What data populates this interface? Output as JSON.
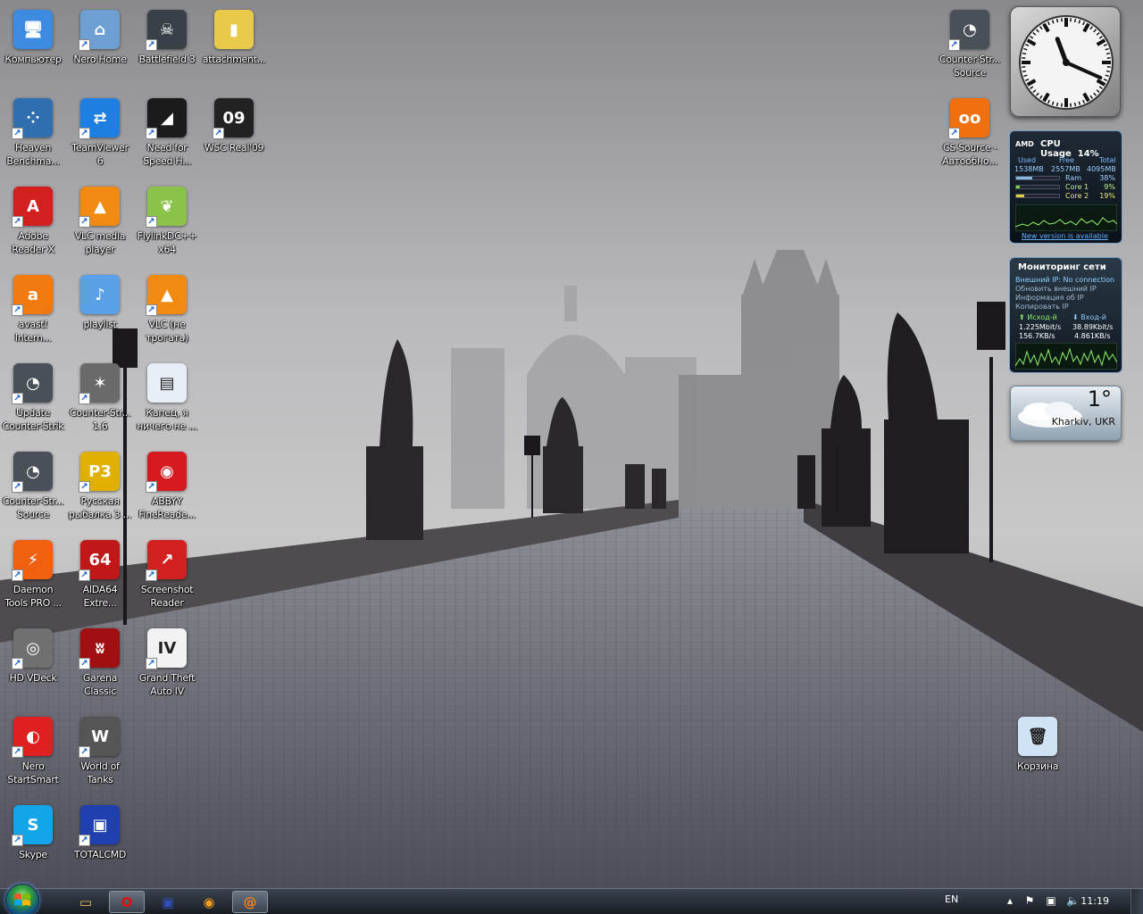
{
  "desktop_icons": [
    {
      "label": "Компьютер",
      "icon": "computer-icon",
      "col": 0,
      "row": 0,
      "color": "#3d8be0",
      "glyph": "🖥"
    },
    {
      "label": "Nero Home",
      "icon": "nero-home-icon",
      "col": 1,
      "row": 0,
      "color": "#6d9fd4",
      "glyph": "⌂"
    },
    {
      "label": "Battlefield 3",
      "icon": "battlefield-icon",
      "col": 2,
      "row": 0,
      "color": "#3a4048",
      "glyph": "☠"
    },
    {
      "label": "attachment...",
      "icon": "zip-folder-icon",
      "col": 3,
      "row": 0,
      "color": "#e8c94a",
      "glyph": "▮"
    },
    {
      "label": "Heaven\nBenchma...",
      "icon": "heaven-benchmark-icon",
      "col": 0,
      "row": 1,
      "color": "#2f6fb0",
      "glyph": "⁘"
    },
    {
      "label": "TeamViewer\n6",
      "icon": "teamviewer-icon",
      "col": 1,
      "row": 1,
      "color": "#1f7fe0",
      "glyph": "⇄"
    },
    {
      "label": "Need for\nSpeed H...",
      "icon": "need-for-speed-icon",
      "col": 2,
      "row": 1,
      "color": "#1b1b1b",
      "glyph": "◢"
    },
    {
      "label": "WSC Real'09",
      "icon": "wsc-real-icon",
      "col": 3,
      "row": 1,
      "color": "#222",
      "glyph": "09"
    },
    {
      "label": "Adobe\nReader X",
      "icon": "adobe-reader-icon",
      "col": 0,
      "row": 2,
      "color": "#d21f1f",
      "glyph": "A"
    },
    {
      "label": "VLC media\nplayer",
      "icon": "vlc-icon",
      "col": 1,
      "row": 2,
      "color": "#f08a10",
      "glyph": "▲"
    },
    {
      "label": "FlylinkDC++\nx64",
      "icon": "flylinkdc-icon",
      "col": 2,
      "row": 2,
      "color": "#8bc34a",
      "glyph": "❦"
    },
    {
      "label": "avast!\nIntern...",
      "icon": "avast-icon",
      "col": 0,
      "row": 3,
      "color": "#f07a10",
      "glyph": "a"
    },
    {
      "label": "playlist",
      "icon": "playlist-file-icon",
      "col": 1,
      "row": 3,
      "color": "#5aa0e6",
      "glyph": "♪"
    },
    {
      "label": "VLC (не\nтрогать)",
      "icon": "vlc-icon",
      "col": 2,
      "row": 3,
      "color": "#f08a10",
      "glyph": "▲"
    },
    {
      "label": "Update\nCounter-Strik\ne Source",
      "icon": "cs-source-icon",
      "col": 0,
      "row": 4,
      "color": "#4a5058",
      "glyph": "◔"
    },
    {
      "label": "Counter-Str...\n1.6",
      "icon": "counter-strike-icon",
      "col": 1,
      "row": 4,
      "color": "#6a6a6a",
      "glyph": "✶"
    },
    {
      "label": "Капец, я\nничего не ...",
      "icon": "screenshot-file-icon",
      "col": 2,
      "row": 4,
      "color": "#e8eef6",
      "glyph": "▤"
    },
    {
      "label": "Counter-Str...\nSource",
      "icon": "cs-source-icon",
      "col": 0,
      "row": 5,
      "color": "#4a5058",
      "glyph": "◔"
    },
    {
      "label": "Русская\nрыбалка 3 ...",
      "icon": "russian-fishing-icon",
      "col": 1,
      "row": 5,
      "color": "#e0b000",
      "glyph": "P3"
    },
    {
      "label": "ABBYY\nFineReade...",
      "icon": "abbyy-icon",
      "col": 2,
      "row": 5,
      "color": "#d71920",
      "glyph": "◉"
    },
    {
      "label": "Daemon\nTools PRO ...",
      "icon": "daemon-tools-icon",
      "col": 0,
      "row": 6,
      "color": "#f06010",
      "glyph": "⚡"
    },
    {
      "label": "AIDA64\nExtre...",
      "icon": "aida64-icon",
      "col": 1,
      "row": 6,
      "color": "#c01818",
      "glyph": "64"
    },
    {
      "label": "Screenshot\nReader",
      "icon": "screenshot-reader-icon",
      "col": 2,
      "row": 6,
      "color": "#d22020",
      "glyph": "↗"
    },
    {
      "label": "HD VDeck",
      "icon": "hd-vdeck-icon",
      "col": 0,
      "row": 7,
      "color": "#707070",
      "glyph": "◎"
    },
    {
      "label": "Garena\nClassic",
      "icon": "garena-icon",
      "col": 1,
      "row": 7,
      "color": "#a01010",
      "glyph": "ʬ"
    },
    {
      "label": "Grand Theft\nAuto IV",
      "icon": "gta-iv-icon",
      "col": 2,
      "row": 7,
      "color": "#f2f2f2",
      "glyph": "IV"
    },
    {
      "label": "Nero\nStartSmart",
      "icon": "nero-startsmart-icon",
      "col": 0,
      "row": 8,
      "color": "#e02020",
      "glyph": "◐"
    },
    {
      "label": "World of\nTanks",
      "icon": "world-of-tanks-icon",
      "col": 1,
      "row": 8,
      "color": "#555",
      "glyph": "W"
    },
    {
      "label": "Skype",
      "icon": "skype-icon",
      "col": 0,
      "row": 9,
      "color": "#12a5e8",
      "glyph": "S"
    },
    {
      "label": "TOTALCMD",
      "icon": "total-commander-icon",
      "col": 1,
      "row": 9,
      "color": "#2040b0",
      "glyph": "▣"
    }
  ],
  "right_icons": [
    {
      "label": "Counter-Str...\nSource",
      "icon": "cs-source-icon",
      "color": "#4a5058",
      "glyph": "◔"
    },
    {
      "label": "CS Source -\nАвтообно...",
      "icon": "cs-autoupdate-icon",
      "color": "#f07010",
      "glyph": "oo"
    },
    {
      "label": "Корзина",
      "icon": "recycle-bin-icon",
      "color": "#cfe3f5",
      "glyph": "🗑"
    }
  ],
  "cpu_gadget": {
    "brand": "AMD",
    "title": "CPU Usage",
    "percent": "14%",
    "headers": [
      "Used",
      "Free",
      "Total"
    ],
    "values": [
      "1538MB",
      "2557MB",
      "4095MB"
    ],
    "ram_label": "Ram",
    "ram_value": "38%",
    "core1_label": "Core 1",
    "core1_value": "9%",
    "core2_label": "Core 2",
    "core2_value": "19%",
    "ram_fill": 0.38,
    "core1_fill": 0.09,
    "core2_fill": 0.19,
    "link": "New version is available"
  },
  "net_gadget": {
    "title": "Мониторинг сети",
    "external_ip": "Внешний IP: No connection",
    "refresh": "Обновить внешний IP",
    "info": "Информация об IP",
    "copy": "Копировать IP",
    "out_label": "Исход-й",
    "in_label": "Вход-й",
    "out_bits": "1.225Mbit/s",
    "in_bits": "38.89Kbit/s",
    "out_bytes": "156.7KB/s",
    "in_bytes": "4.861KB/s"
  },
  "weather_gadget": {
    "temperature": "1°",
    "city": "Kharkiv, UKR"
  },
  "taskbar": {
    "language": "EN",
    "time": "11:19",
    "pinned": [
      {
        "name": "explorer",
        "icon": "folder-icon",
        "active": false
      },
      {
        "name": "opera",
        "icon": "opera-icon",
        "active": true
      },
      {
        "name": "totalcmd",
        "icon": "floppy-icon",
        "active": false
      },
      {
        "name": "aimp",
        "icon": "aimp-icon",
        "active": false
      },
      {
        "name": "mail-agent",
        "icon": "mail-agent-icon",
        "active": true
      }
    ]
  },
  "colors": {
    "accent": "#1a5fc4",
    "taskbar": "#1e232a"
  }
}
